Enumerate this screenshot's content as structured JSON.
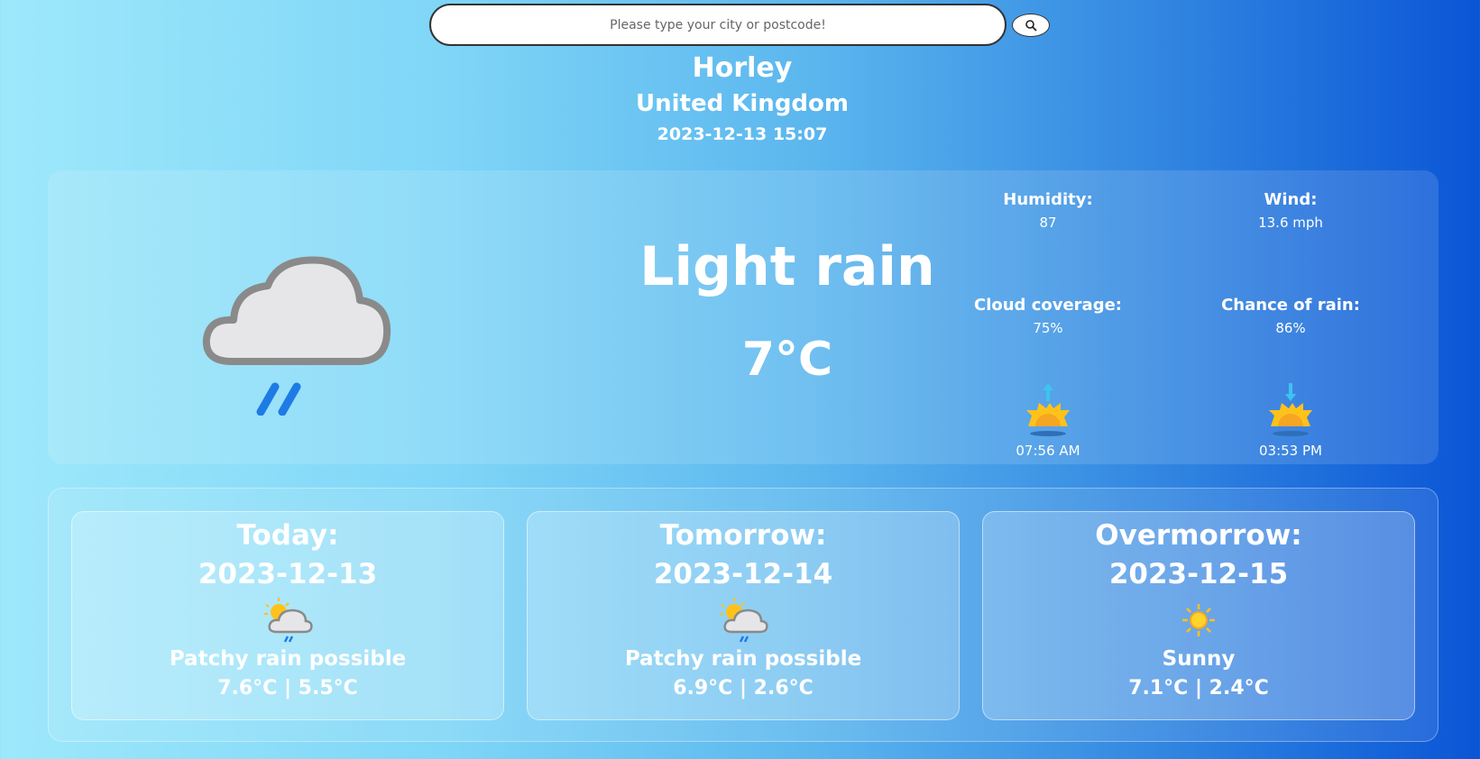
{
  "search": {
    "placeholder": "Please type your city or postcode!"
  },
  "location": {
    "city": "Horley",
    "country": "United Kingdom",
    "datetime": "2023-12-13 15:07"
  },
  "current": {
    "condition": "Light rain",
    "temperature": "7°C",
    "icon": "rain-cloud-icon",
    "humidity": {
      "label": "Humidity:",
      "value": "87"
    },
    "wind": {
      "label": "Wind:",
      "value": "13.6 mph"
    },
    "cloud": {
      "label": "Cloud coverage:",
      "value": "75%"
    },
    "rain": {
      "label": "Chance of rain:",
      "value": "86%"
    },
    "sunrise": "07:56 AM",
    "sunset": "03:53 PM"
  },
  "forecast": [
    {
      "title": "Today:",
      "date": "2023-12-13",
      "condition": "Patchy rain possible",
      "temps": "7.6°C | 5.5°C",
      "icon": "sun-cloud-rain-icon"
    },
    {
      "title": "Tomorrow:",
      "date": "2023-12-14",
      "condition": "Patchy rain possible",
      "temps": "6.9°C | 2.6°C",
      "icon": "sun-cloud-rain-icon"
    },
    {
      "title": "Overmorrow:",
      "date": "2023-12-15",
      "condition": "Sunny",
      "temps": "7.1°C | 2.4°C",
      "icon": "sun-icon"
    }
  ],
  "colors": {
    "sun": "#ffc21a",
    "rain": "#1e7be6",
    "cloud": "#e6e6e8",
    "cloud_outline": "#8a8a8a"
  }
}
